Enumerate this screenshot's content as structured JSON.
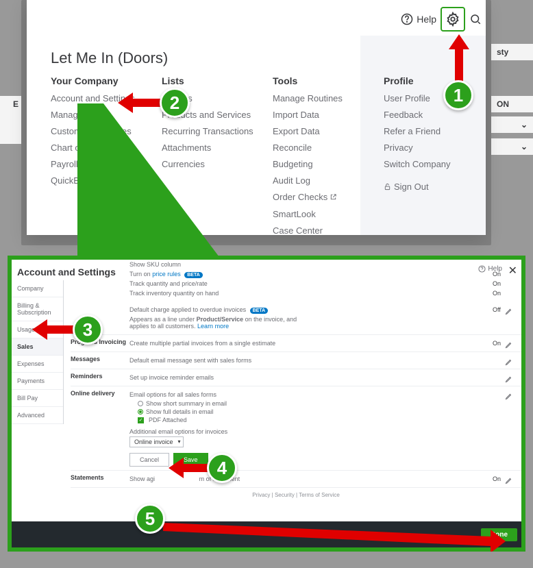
{
  "top": {
    "help_label": "Help",
    "company_name": "Let Me In (Doors)",
    "columns": {
      "your_company": {
        "title": "Your Company",
        "items": [
          "Account and Settings",
          "Manage Users",
          "Custom Form Styles",
          "Chart of Accounts",
          "Payroll Settings",
          "QuickBooks Labs"
        ]
      },
      "lists": {
        "title": "Lists",
        "items": [
          "All Lists",
          "Products and Services",
          "Recurring Transactions",
          "Attachments",
          "Currencies"
        ]
      },
      "tools": {
        "title": "Tools",
        "items": [
          "Manage Routines",
          "Import Data",
          "Export Data",
          "Reconcile",
          "Budgeting",
          "Audit Log",
          "Order Checks",
          "SmartLook",
          "Case Center"
        ]
      },
      "profile": {
        "title": "Profile",
        "items": [
          "User Profile",
          "Feedback",
          "Refer a Friend",
          "Privacy",
          "Switch Company"
        ],
        "signout": "Sign Out"
      }
    }
  },
  "partial_bg": {
    "left_label": "E",
    "right1": "sty",
    "right2": "ON"
  },
  "settings": {
    "title": "Account and Settings",
    "help": "Help",
    "sidebar": [
      "Company",
      "Billing & Subscription",
      "Usage",
      "Sales",
      "Expenses",
      "Payments",
      "Bill Pay",
      "Advanced"
    ],
    "active_index": 3,
    "content": {
      "top_lines": [
        {
          "txt": "Show SKU column",
          "val": ""
        },
        {
          "txt_pre": "Turn on ",
          "link": "price rules",
          "beta": "BETA",
          "val": "On"
        },
        {
          "txt": "Track quantity and price/rate",
          "val": "On"
        },
        {
          "txt": "Track inventory quantity on hand",
          "val": "On"
        }
      ],
      "late_fees": {
        "line1_pre": "Default charge applied to overdue invoices",
        "beta": "BETA",
        "val": "Off",
        "desc_pre": "Appears as a line under ",
        "bold": "Product/Service",
        "desc_mid": " on the invoice, and applies to all customers. ",
        "learn": "Learn more"
      },
      "progress": {
        "label": "Progress Invoicing",
        "txt": "Create multiple partial invoices from a single estimate",
        "val": "On"
      },
      "messages": {
        "label": "Messages",
        "txt": "Default email message sent with sales forms"
      },
      "reminders": {
        "label": "Reminders",
        "txt": "Set up invoice reminder emails"
      },
      "online": {
        "label": "Online delivery",
        "heading": "Email options for all sales forms",
        "opt1": "Show short summary in email",
        "opt2": "Show full details in email",
        "pdf": "PDF Attached",
        "addl": "Additional email options for invoices",
        "dd": "Online invoice",
        "cancel": "Cancel",
        "save": "Save"
      },
      "statements": {
        "label": "Statements",
        "txt_pre": "Show agi",
        "txt_post": "m of statement",
        "val": "On"
      }
    },
    "footer": {
      "links": "Privacy  |  Security  |  Terms of Service",
      "done": "Done"
    }
  },
  "badges": {
    "b1": "1",
    "b2": "2",
    "b3": "3",
    "b4": "4",
    "b5": "5"
  }
}
